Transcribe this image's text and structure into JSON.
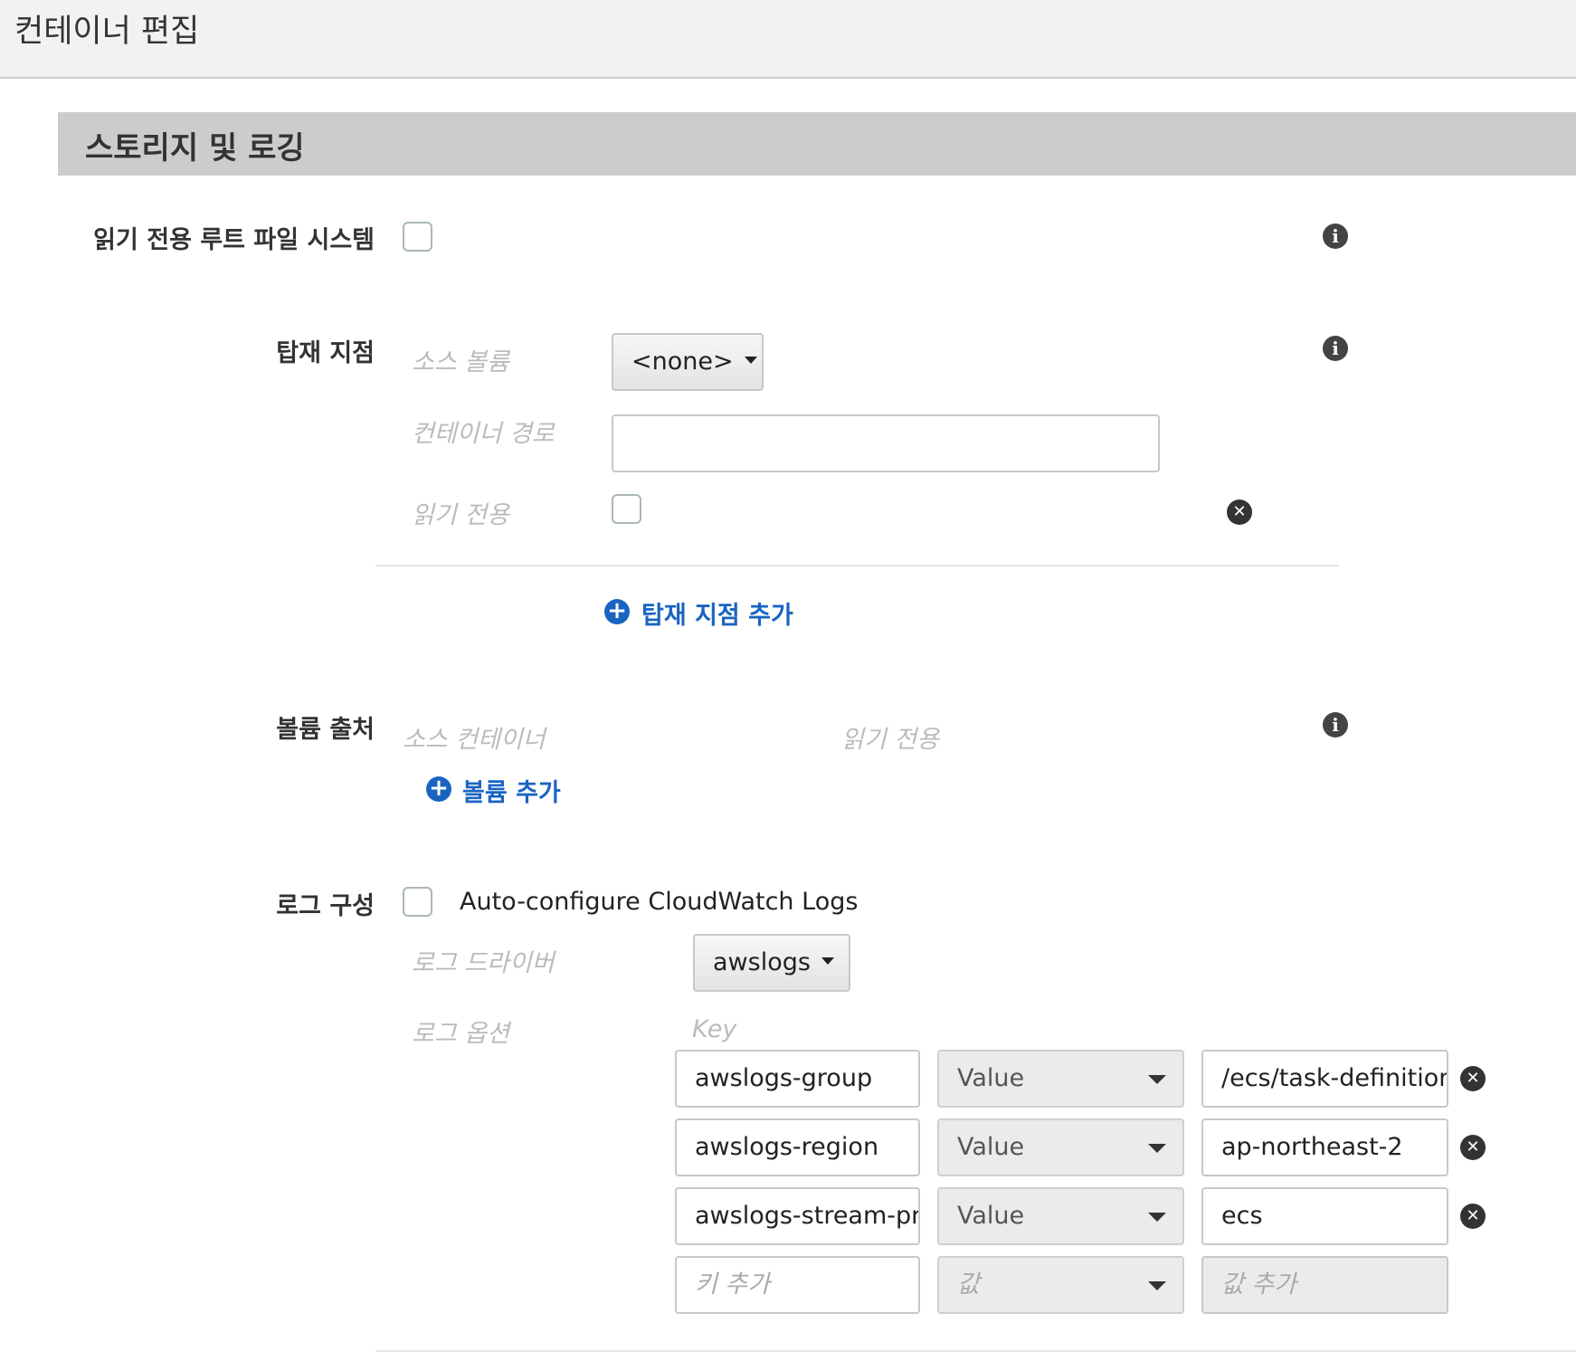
{
  "header": {
    "title": "컨테이너 편집"
  },
  "section": {
    "title": "스토리지 및 로깅"
  },
  "readonly_root": {
    "label": "읽기 전용 루트 파일 시스템"
  },
  "mount_points": {
    "label": "탑재 지점",
    "source_volume_label": "소스 볼륨",
    "source_volume_value": "<none>",
    "container_path_label": "컨테이너 경로",
    "container_path_value": "",
    "read_only_label": "읽기 전용",
    "add_label": "탑재 지점 추가"
  },
  "volumes_from": {
    "label": "볼륨 출처",
    "source_container_label": "소스 컨테이너",
    "read_only_label": "읽기 전용",
    "add_label": "볼륨 추가"
  },
  "log_config": {
    "label": "로그 구성",
    "auto_configure_label": "Auto-configure CloudWatch Logs",
    "driver_label": "로그 드라이버",
    "driver_value": "awslogs",
    "options_label": "로그 옵션",
    "key_header": "Key",
    "options": [
      {
        "key": "awslogs-group",
        "type": "Value",
        "value": "/ecs/task-definition"
      },
      {
        "key": "awslogs-region",
        "type": "Value",
        "value": "ap-northeast-2"
      },
      {
        "key": "awslogs-stream-prefix",
        "type": "Value",
        "value": "ecs"
      }
    ],
    "new_option": {
      "key_placeholder": "키 추가",
      "type_placeholder": "값",
      "value_placeholder": "값 추가"
    }
  },
  "icons": {
    "info": "info-icon",
    "remove": "remove-icon",
    "add": "plus-circle-icon",
    "caret": "caret-down-icon"
  }
}
